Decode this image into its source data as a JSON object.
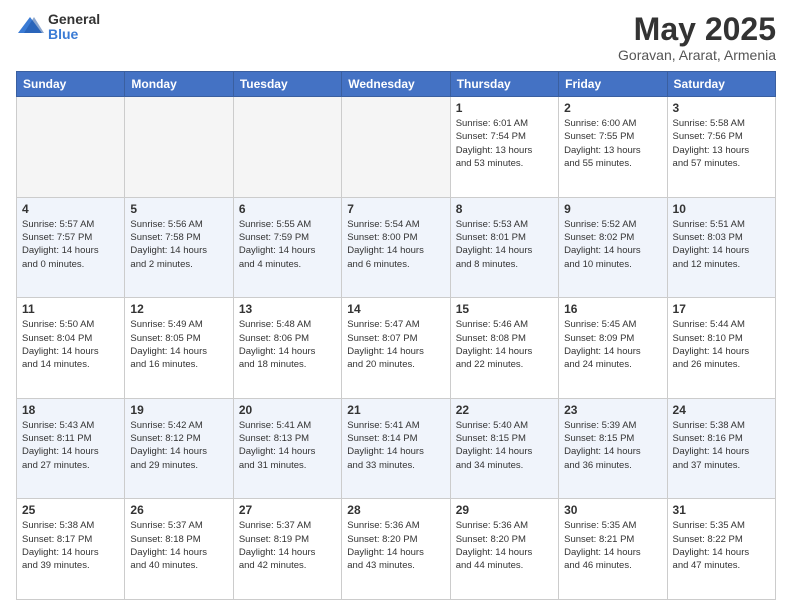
{
  "header": {
    "logo_general": "General",
    "logo_blue": "Blue",
    "title": "May 2025",
    "subtitle": "Goravan, Ararat, Armenia"
  },
  "calendar": {
    "days_of_week": [
      "Sunday",
      "Monday",
      "Tuesday",
      "Wednesday",
      "Thursday",
      "Friday",
      "Saturday"
    ],
    "weeks": [
      [
        {
          "day": "",
          "info": ""
        },
        {
          "day": "",
          "info": ""
        },
        {
          "day": "",
          "info": ""
        },
        {
          "day": "",
          "info": ""
        },
        {
          "day": "1",
          "info": "Sunrise: 6:01 AM\nSunset: 7:54 PM\nDaylight: 13 hours\nand 53 minutes."
        },
        {
          "day": "2",
          "info": "Sunrise: 6:00 AM\nSunset: 7:55 PM\nDaylight: 13 hours\nand 55 minutes."
        },
        {
          "day": "3",
          "info": "Sunrise: 5:58 AM\nSunset: 7:56 PM\nDaylight: 13 hours\nand 57 minutes."
        }
      ],
      [
        {
          "day": "4",
          "info": "Sunrise: 5:57 AM\nSunset: 7:57 PM\nDaylight: 14 hours\nand 0 minutes."
        },
        {
          "day": "5",
          "info": "Sunrise: 5:56 AM\nSunset: 7:58 PM\nDaylight: 14 hours\nand 2 minutes."
        },
        {
          "day": "6",
          "info": "Sunrise: 5:55 AM\nSunset: 7:59 PM\nDaylight: 14 hours\nand 4 minutes."
        },
        {
          "day": "7",
          "info": "Sunrise: 5:54 AM\nSunset: 8:00 PM\nDaylight: 14 hours\nand 6 minutes."
        },
        {
          "day": "8",
          "info": "Sunrise: 5:53 AM\nSunset: 8:01 PM\nDaylight: 14 hours\nand 8 minutes."
        },
        {
          "day": "9",
          "info": "Sunrise: 5:52 AM\nSunset: 8:02 PM\nDaylight: 14 hours\nand 10 minutes."
        },
        {
          "day": "10",
          "info": "Sunrise: 5:51 AM\nSunset: 8:03 PM\nDaylight: 14 hours\nand 12 minutes."
        }
      ],
      [
        {
          "day": "11",
          "info": "Sunrise: 5:50 AM\nSunset: 8:04 PM\nDaylight: 14 hours\nand 14 minutes."
        },
        {
          "day": "12",
          "info": "Sunrise: 5:49 AM\nSunset: 8:05 PM\nDaylight: 14 hours\nand 16 minutes."
        },
        {
          "day": "13",
          "info": "Sunrise: 5:48 AM\nSunset: 8:06 PM\nDaylight: 14 hours\nand 18 minutes."
        },
        {
          "day": "14",
          "info": "Sunrise: 5:47 AM\nSunset: 8:07 PM\nDaylight: 14 hours\nand 20 minutes."
        },
        {
          "day": "15",
          "info": "Sunrise: 5:46 AM\nSunset: 8:08 PM\nDaylight: 14 hours\nand 22 minutes."
        },
        {
          "day": "16",
          "info": "Sunrise: 5:45 AM\nSunset: 8:09 PM\nDaylight: 14 hours\nand 24 minutes."
        },
        {
          "day": "17",
          "info": "Sunrise: 5:44 AM\nSunset: 8:10 PM\nDaylight: 14 hours\nand 26 minutes."
        }
      ],
      [
        {
          "day": "18",
          "info": "Sunrise: 5:43 AM\nSunset: 8:11 PM\nDaylight: 14 hours\nand 27 minutes."
        },
        {
          "day": "19",
          "info": "Sunrise: 5:42 AM\nSunset: 8:12 PM\nDaylight: 14 hours\nand 29 minutes."
        },
        {
          "day": "20",
          "info": "Sunrise: 5:41 AM\nSunset: 8:13 PM\nDaylight: 14 hours\nand 31 minutes."
        },
        {
          "day": "21",
          "info": "Sunrise: 5:41 AM\nSunset: 8:14 PM\nDaylight: 14 hours\nand 33 minutes."
        },
        {
          "day": "22",
          "info": "Sunrise: 5:40 AM\nSunset: 8:15 PM\nDaylight: 14 hours\nand 34 minutes."
        },
        {
          "day": "23",
          "info": "Sunrise: 5:39 AM\nSunset: 8:15 PM\nDaylight: 14 hours\nand 36 minutes."
        },
        {
          "day": "24",
          "info": "Sunrise: 5:38 AM\nSunset: 8:16 PM\nDaylight: 14 hours\nand 37 minutes."
        }
      ],
      [
        {
          "day": "25",
          "info": "Sunrise: 5:38 AM\nSunset: 8:17 PM\nDaylight: 14 hours\nand 39 minutes."
        },
        {
          "day": "26",
          "info": "Sunrise: 5:37 AM\nSunset: 8:18 PM\nDaylight: 14 hours\nand 40 minutes."
        },
        {
          "day": "27",
          "info": "Sunrise: 5:37 AM\nSunset: 8:19 PM\nDaylight: 14 hours\nand 42 minutes."
        },
        {
          "day": "28",
          "info": "Sunrise: 5:36 AM\nSunset: 8:20 PM\nDaylight: 14 hours\nand 43 minutes."
        },
        {
          "day": "29",
          "info": "Sunrise: 5:36 AM\nSunset: 8:20 PM\nDaylight: 14 hours\nand 44 minutes."
        },
        {
          "day": "30",
          "info": "Sunrise: 5:35 AM\nSunset: 8:21 PM\nDaylight: 14 hours\nand 46 minutes."
        },
        {
          "day": "31",
          "info": "Sunrise: 5:35 AM\nSunset: 8:22 PM\nDaylight: 14 hours\nand 47 minutes."
        }
      ]
    ]
  }
}
